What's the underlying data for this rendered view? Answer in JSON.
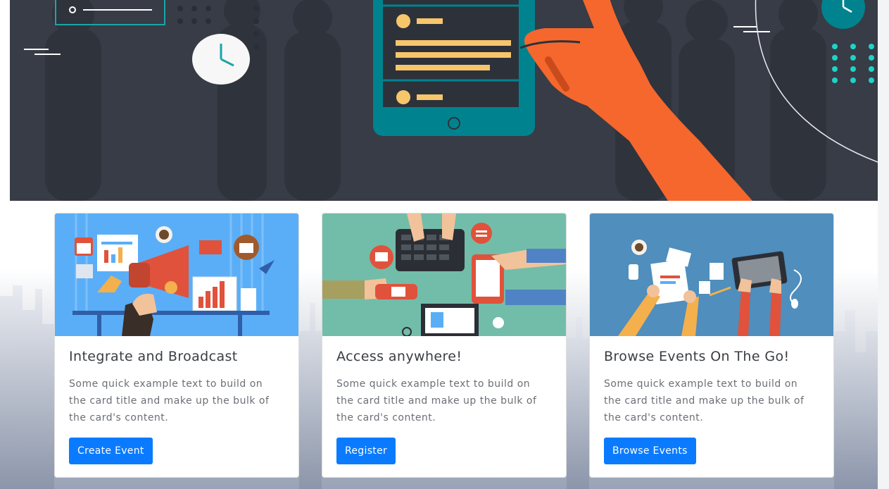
{
  "colors": {
    "hero_bg": "#373c46",
    "primary_button": "#0a7bff",
    "teal": "#00838f",
    "orange": "#f5672d",
    "yellow": "#f7c66b"
  },
  "hero": {
    "illustration": "hand-holding-tablet-with-clock-icons"
  },
  "cards": [
    {
      "image": "megaphone-broadcast-illustration",
      "title": "Integrate and Broadcast",
      "text": "Some quick example text to build on the card title and make up the bulk of the card's content.",
      "button": "Create Event"
    },
    {
      "image": "devices-and-hands-illustration",
      "title": "Access anywhere!",
      "text": "Some quick example text to build on the card title and make up the bulk of the card's content.",
      "button": "Register"
    },
    {
      "image": "desk-laptop-illustration",
      "title": "Browse Events On The Go!",
      "text": "Some quick example text to build on the card title and make up the bulk of the card's content.",
      "button": "Browse Events"
    }
  ]
}
